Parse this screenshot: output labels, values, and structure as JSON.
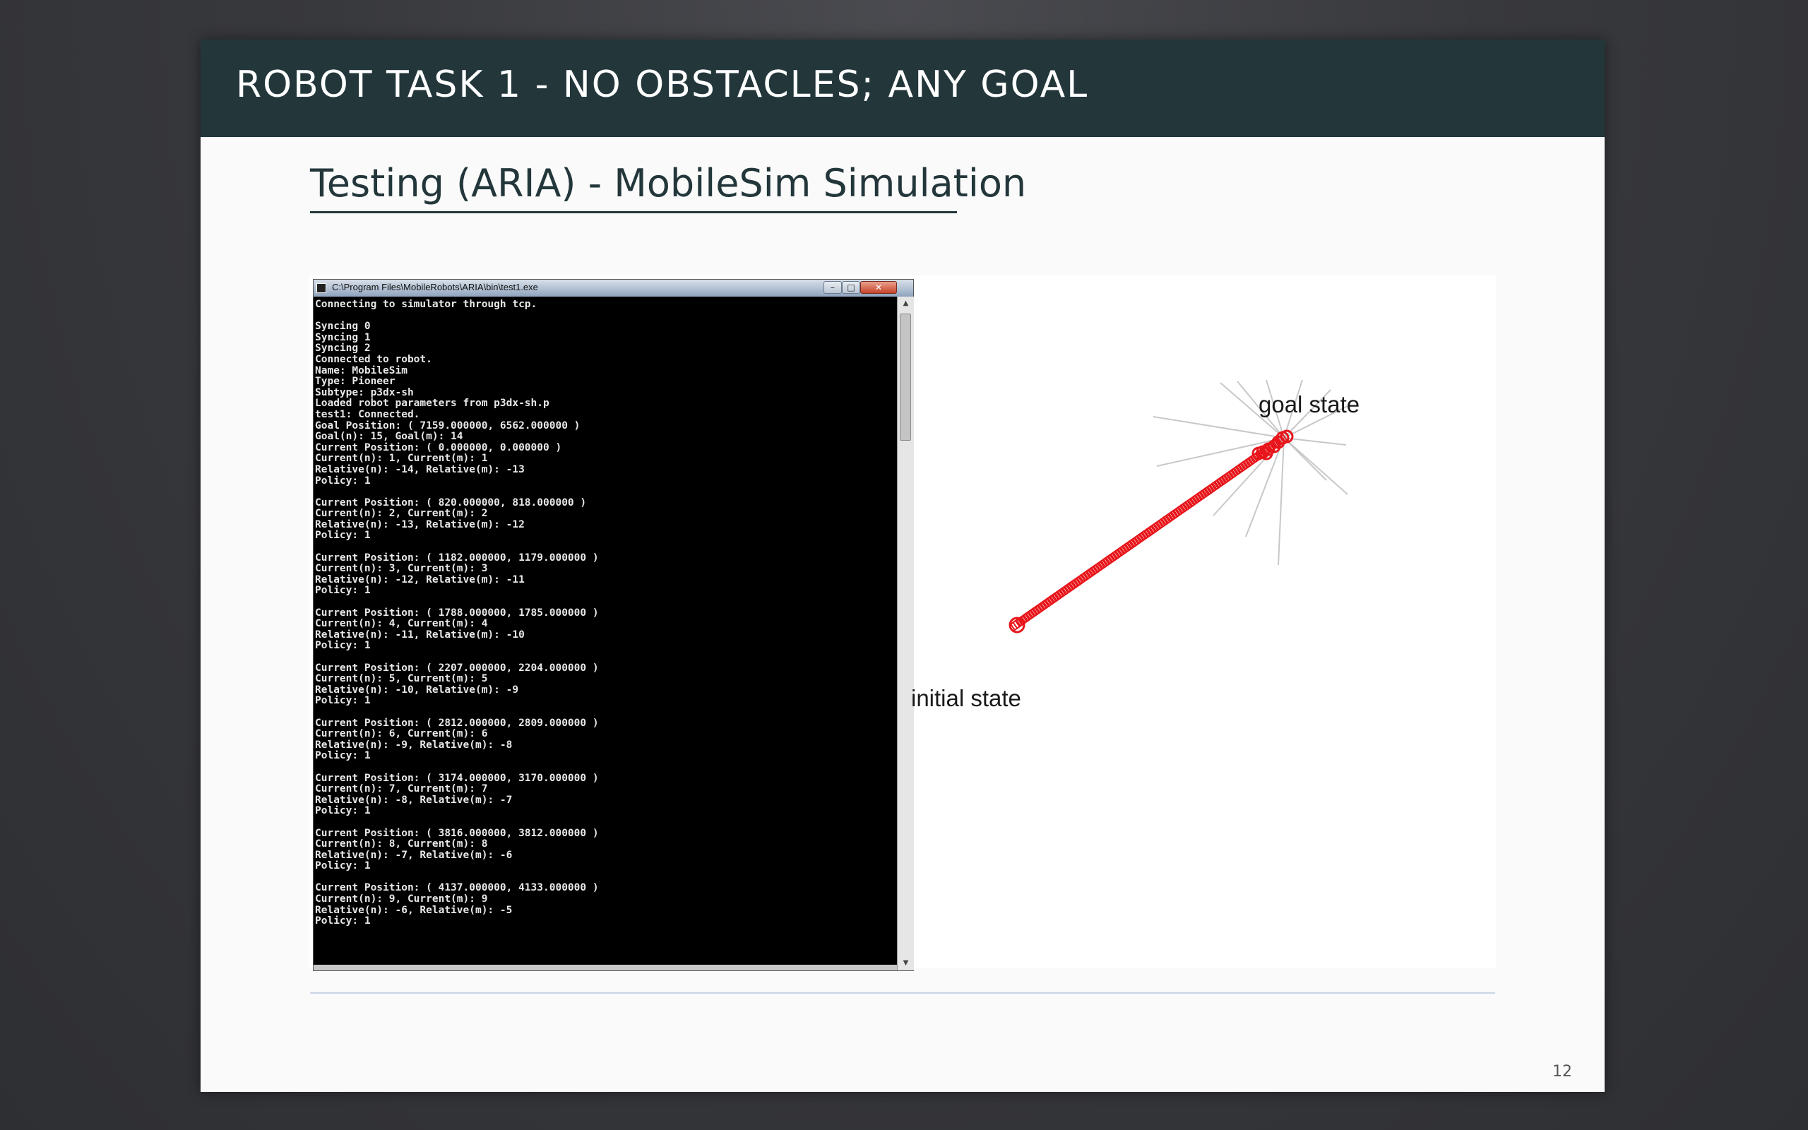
{
  "slide": {
    "title": "ROBOT TASK 1 - NO OBSTACLES; ANY GOAL",
    "subtitle": "Testing (ARIA) - MobileSim Simulation",
    "page_number": "12"
  },
  "console": {
    "window_title": "C:\\Program Files\\MobileRobots\\ARIA\\bin\\test1.exe",
    "buttons": {
      "minimize": "–",
      "maximize": "□",
      "close": "✕"
    },
    "output": "Connecting to simulator through tcp.\n\nSyncing 0\nSyncing 1\nSyncing 2\nConnected to robot.\nName: MobileSim\nType: Pioneer\nSubtype: p3dx-sh\nLoaded robot parameters from p3dx-sh.p\ntest1: Connected.\nGoal Position: ( 7159.000000, 6562.000000 )\nGoal(n): 15, Goal(m): 14\nCurrent Position: ( 0.000000, 0.000000 )\nCurrent(n): 1, Current(m): 1\nRelative(n): -14, Relative(m): -13\nPolicy: 1\n\nCurrent Position: ( 820.000000, 818.000000 )\nCurrent(n): 2, Current(m): 2\nRelative(n): -13, Relative(m): -12\nPolicy: 1\n\nCurrent Position: ( 1182.000000, 1179.000000 )\nCurrent(n): 3, Current(m): 3\nRelative(n): -12, Relative(m): -11\nPolicy: 1\n\nCurrent Position: ( 1788.000000, 1785.000000 )\nCurrent(n): 4, Current(m): 4\nRelative(n): -11, Relative(m): -10\nPolicy: 1\n\nCurrent Position: ( 2207.000000, 2204.000000 )\nCurrent(n): 5, Current(m): 5\nRelative(n): -10, Relative(m): -9\nPolicy: 1\n\nCurrent Position: ( 2812.000000, 2809.000000 )\nCurrent(n): 6, Current(m): 6\nRelative(n): -9, Relative(m): -8\nPolicy: 1\n\nCurrent Position: ( 3174.000000, 3170.000000 )\nCurrent(n): 7, Current(m): 7\nRelative(n): -8, Relative(m): -7\nPolicy: 1\n\nCurrent Position: ( 3816.000000, 3812.000000 )\nCurrent(n): 8, Current(m): 8\nRelative(n): -7, Relative(m): -6\nPolicy: 1\n\nCurrent Position: ( 4137.000000, 4133.000000 )\nCurrent(n): 9, Current(m): 9\nRelative(n): -6, Relative(m): -5\nPolicy: 1"
  },
  "simulation": {
    "goal_label": "goal state",
    "initial_label": "initial state",
    "path_color": "#e8161b",
    "sensor_color": "#c8c8c8"
  }
}
